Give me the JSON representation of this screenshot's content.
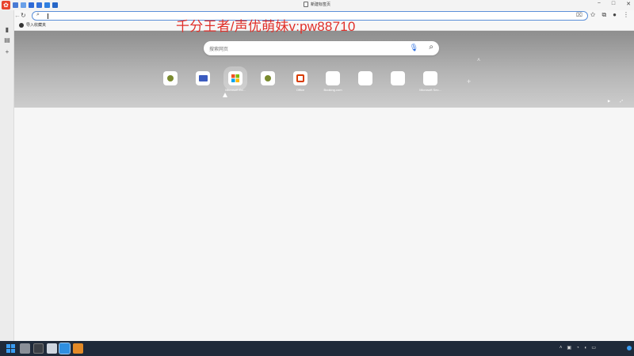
{
  "window": {
    "tab_title": "新建标签页",
    "controls": [
      "−",
      "□",
      "✕"
    ]
  },
  "toolbar": {
    "back": "←",
    "reload": "↻",
    "address_value": "",
    "search_glyph": "⌕"
  },
  "bookmarks": {
    "items": [
      {
        "label": "导入收藏夹"
      }
    ]
  },
  "newtab": {
    "search_placeholder": "搜索网页",
    "shortcuts": [
      {
        "label": "",
        "color": "#7a8a2e"
      },
      {
        "label": "",
        "color": "#3b5bbf"
      },
      {
        "label": "Microsoft Ed...",
        "color": "#f25022"
      },
      {
        "label": "",
        "color": "#7a8a2e"
      },
      {
        "label": "Office",
        "color": "#d83b01"
      },
      {
        "label": "Booking.com",
        "color": "#ffffff"
      },
      {
        "label": "",
        "color": "#ffffff"
      },
      {
        "label": "",
        "color": "#ffffff"
      },
      {
        "label": "Microsoft Sec...",
        "color": "#ffffff"
      }
    ],
    "footer_left": "",
    "footer_right": [
      "",
      ""
    ]
  },
  "overlay_text": "千分王者/声优萌妹v:pw88710",
  "taskbar": {
    "clock_time": "",
    "clock_date": ""
  }
}
